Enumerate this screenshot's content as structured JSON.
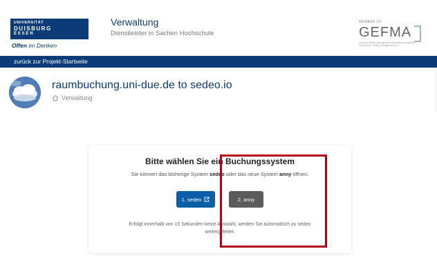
{
  "header": {
    "uni_logo": {
      "line1": "UNIVERSITÄT",
      "line2": "DUISBURG",
      "line3": "ESSEN",
      "tagline_prefix": "Offen",
      "tagline_suffix": "im Denken"
    },
    "title": "Verwaltung",
    "subtitle": "Dienstleister in Sachen Hochschule",
    "partner_logo": {
      "member_text": "MEMBER OF",
      "brand": "GEFMA",
      "fine_print": "German Facility Management Association Deutscher Verband für Facility Management e.V."
    }
  },
  "nav": {
    "back_link": "zurück zur Projekt-Startseite"
  },
  "project": {
    "title": "raumbuchung.uni-due.de to sedeo.io",
    "breadcrumb": "Verwaltung",
    "home_icon": "home-icon"
  },
  "card": {
    "title": "Bitte wählen Sie ein Buchungssystem",
    "desc_prefix": "Sie können das bisherige System ",
    "desc_system1": "sedeo",
    "desc_middle": " oder das neue System ",
    "desc_system2": "anny",
    "desc_suffix": " öffnen.",
    "button1_label": "1. sedeo",
    "button1_icon": "external-link-icon",
    "button2_label": "2. anny",
    "footnote": "Erfolgt innerhalb von 15 Sekunden keine Auswahl, werden Sie automatisch zu sedeo weitergeleitet."
  },
  "colors": {
    "brand_blue": "#0b3c78",
    "button_blue": "#0b5ea8",
    "button_grey": "#5b5b5b",
    "highlight_red": "#b40014"
  }
}
